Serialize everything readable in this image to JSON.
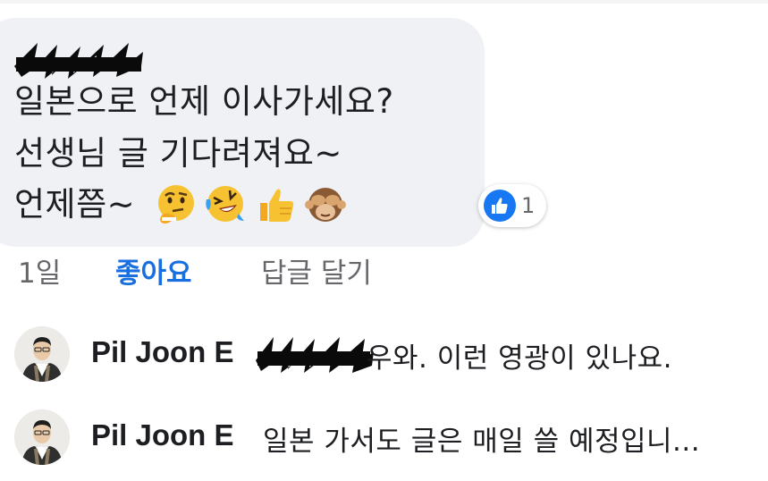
{
  "comment": {
    "lines": [
      "일본으로 언제 이사가세요?",
      "선생님 글 기다려져요~",
      "언제쯤~"
    ],
    "emojis": [
      "thinking-face-icon",
      "rolling-on-floor-laughing-icon",
      "thumbs-up-icon",
      "see-no-evil-monkey-icon"
    ],
    "reaction_count": "1",
    "age": "1일",
    "like_label": "좋아요",
    "reply_label": "답글 달기"
  },
  "replies": [
    {
      "name": "Pil Joon E",
      "text": "우와. 이런 영광이 있나요."
    },
    {
      "name": "Pil Joon E",
      "text": "일본 가서도 글은 매일 쓸 예정입니..."
    }
  ],
  "colors": {
    "like_blue": "#1a6fe0",
    "bubble": "#eff1f4",
    "reaction_blue": "#1877f2",
    "muted": "#65676b"
  }
}
